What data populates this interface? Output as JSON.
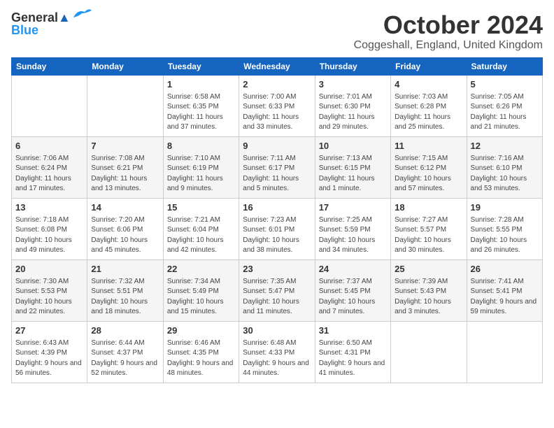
{
  "header": {
    "logo_line1": "General",
    "logo_line2": "Blue",
    "month": "October 2024",
    "location": "Coggeshall, England, United Kingdom"
  },
  "days_of_week": [
    "Sunday",
    "Monday",
    "Tuesday",
    "Wednesday",
    "Thursday",
    "Friday",
    "Saturday"
  ],
  "weeks": [
    [
      {
        "day": "",
        "info": ""
      },
      {
        "day": "",
        "info": ""
      },
      {
        "day": "1",
        "info": "Sunrise: 6:58 AM\nSunset: 6:35 PM\nDaylight: 11 hours and 37 minutes."
      },
      {
        "day": "2",
        "info": "Sunrise: 7:00 AM\nSunset: 6:33 PM\nDaylight: 11 hours and 33 minutes."
      },
      {
        "day": "3",
        "info": "Sunrise: 7:01 AM\nSunset: 6:30 PM\nDaylight: 11 hours and 29 minutes."
      },
      {
        "day": "4",
        "info": "Sunrise: 7:03 AM\nSunset: 6:28 PM\nDaylight: 11 hours and 25 minutes."
      },
      {
        "day": "5",
        "info": "Sunrise: 7:05 AM\nSunset: 6:26 PM\nDaylight: 11 hours and 21 minutes."
      }
    ],
    [
      {
        "day": "6",
        "info": "Sunrise: 7:06 AM\nSunset: 6:24 PM\nDaylight: 11 hours and 17 minutes."
      },
      {
        "day": "7",
        "info": "Sunrise: 7:08 AM\nSunset: 6:21 PM\nDaylight: 11 hours and 13 minutes."
      },
      {
        "day": "8",
        "info": "Sunrise: 7:10 AM\nSunset: 6:19 PM\nDaylight: 11 hours and 9 minutes."
      },
      {
        "day": "9",
        "info": "Sunrise: 7:11 AM\nSunset: 6:17 PM\nDaylight: 11 hours and 5 minutes."
      },
      {
        "day": "10",
        "info": "Sunrise: 7:13 AM\nSunset: 6:15 PM\nDaylight: 11 hours and 1 minute."
      },
      {
        "day": "11",
        "info": "Sunrise: 7:15 AM\nSunset: 6:12 PM\nDaylight: 10 hours and 57 minutes."
      },
      {
        "day": "12",
        "info": "Sunrise: 7:16 AM\nSunset: 6:10 PM\nDaylight: 10 hours and 53 minutes."
      }
    ],
    [
      {
        "day": "13",
        "info": "Sunrise: 7:18 AM\nSunset: 6:08 PM\nDaylight: 10 hours and 49 minutes."
      },
      {
        "day": "14",
        "info": "Sunrise: 7:20 AM\nSunset: 6:06 PM\nDaylight: 10 hours and 45 minutes."
      },
      {
        "day": "15",
        "info": "Sunrise: 7:21 AM\nSunset: 6:04 PM\nDaylight: 10 hours and 42 minutes."
      },
      {
        "day": "16",
        "info": "Sunrise: 7:23 AM\nSunset: 6:01 PM\nDaylight: 10 hours and 38 minutes."
      },
      {
        "day": "17",
        "info": "Sunrise: 7:25 AM\nSunset: 5:59 PM\nDaylight: 10 hours and 34 minutes."
      },
      {
        "day": "18",
        "info": "Sunrise: 7:27 AM\nSunset: 5:57 PM\nDaylight: 10 hours and 30 minutes."
      },
      {
        "day": "19",
        "info": "Sunrise: 7:28 AM\nSunset: 5:55 PM\nDaylight: 10 hours and 26 minutes."
      }
    ],
    [
      {
        "day": "20",
        "info": "Sunrise: 7:30 AM\nSunset: 5:53 PM\nDaylight: 10 hours and 22 minutes."
      },
      {
        "day": "21",
        "info": "Sunrise: 7:32 AM\nSunset: 5:51 PM\nDaylight: 10 hours and 18 minutes."
      },
      {
        "day": "22",
        "info": "Sunrise: 7:34 AM\nSunset: 5:49 PM\nDaylight: 10 hours and 15 minutes."
      },
      {
        "day": "23",
        "info": "Sunrise: 7:35 AM\nSunset: 5:47 PM\nDaylight: 10 hours and 11 minutes."
      },
      {
        "day": "24",
        "info": "Sunrise: 7:37 AM\nSunset: 5:45 PM\nDaylight: 10 hours and 7 minutes."
      },
      {
        "day": "25",
        "info": "Sunrise: 7:39 AM\nSunset: 5:43 PM\nDaylight: 10 hours and 3 minutes."
      },
      {
        "day": "26",
        "info": "Sunrise: 7:41 AM\nSunset: 5:41 PM\nDaylight: 9 hours and 59 minutes."
      }
    ],
    [
      {
        "day": "27",
        "info": "Sunrise: 6:43 AM\nSunset: 4:39 PM\nDaylight: 9 hours and 56 minutes."
      },
      {
        "day": "28",
        "info": "Sunrise: 6:44 AM\nSunset: 4:37 PM\nDaylight: 9 hours and 52 minutes."
      },
      {
        "day": "29",
        "info": "Sunrise: 6:46 AM\nSunset: 4:35 PM\nDaylight: 9 hours and 48 minutes."
      },
      {
        "day": "30",
        "info": "Sunrise: 6:48 AM\nSunset: 4:33 PM\nDaylight: 9 hours and 44 minutes."
      },
      {
        "day": "31",
        "info": "Sunrise: 6:50 AM\nSunset: 4:31 PM\nDaylight: 9 hours and 41 minutes."
      },
      {
        "day": "",
        "info": ""
      },
      {
        "day": "",
        "info": ""
      }
    ]
  ]
}
